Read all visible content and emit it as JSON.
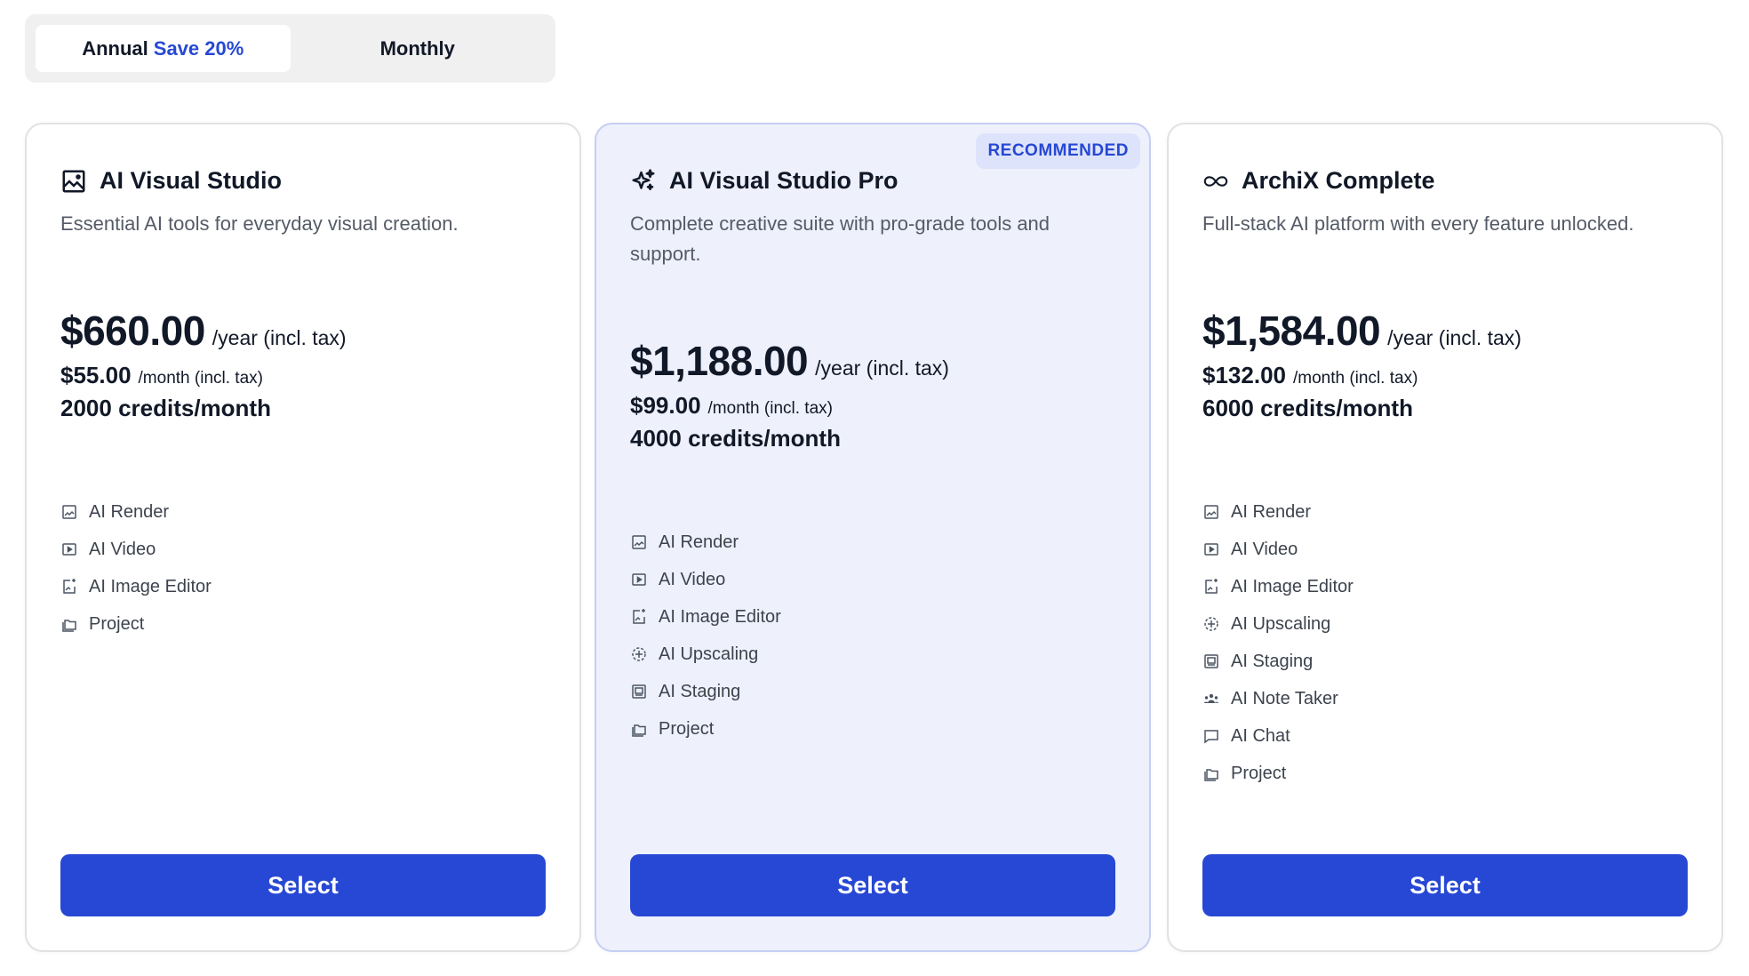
{
  "billing_toggle": {
    "annual_label": "Annual",
    "annual_badge": "Save 20%",
    "monthly_label": "Monthly"
  },
  "plans": [
    {
      "icon": "image-icon",
      "name": "AI Visual Studio",
      "description": "Essential AI tools for everyday visual creation.",
      "price_year": "$660.00",
      "per_year": "/year (incl. tax)",
      "price_month": "$55.00",
      "per_month": "/month (incl. tax)",
      "credits": "2000 credits/month",
      "features": [
        "AI Render",
        "AI Video",
        "AI Image Editor",
        "Project"
      ],
      "button": "Select"
    },
    {
      "icon": "sparkles-icon",
      "name": "AI Visual Studio Pro",
      "badge": "RECOMMENDED",
      "description": "Complete creative suite with pro-grade tools and support.",
      "price_year": "$1,188.00",
      "per_year": "/year (incl. tax)",
      "price_month": "$99.00",
      "per_month": "/month (incl. tax)",
      "credits": "4000 credits/month",
      "features": [
        "AI Render",
        "AI Video",
        "AI Image Editor",
        "AI Upscaling",
        "AI Staging",
        "Project"
      ],
      "button": "Select"
    },
    {
      "icon": "infinity-icon",
      "name": "ArchiX Complete",
      "description": "Full-stack AI platform with every feature unlocked.",
      "price_year": "$1,584.00",
      "per_year": "/year (incl. tax)",
      "price_month": "$132.00",
      "per_month": "/month (incl. tax)",
      "credits": "6000 credits/month",
      "features": [
        "AI Render",
        "AI Video",
        "AI Image Editor",
        "AI Upscaling",
        "AI Staging",
        "AI Note Taker",
        "AI Chat",
        "Project"
      ],
      "button": "Select"
    }
  ],
  "colors": {
    "accent": "#2748d4",
    "recommended_bg": "#eef0fc"
  }
}
